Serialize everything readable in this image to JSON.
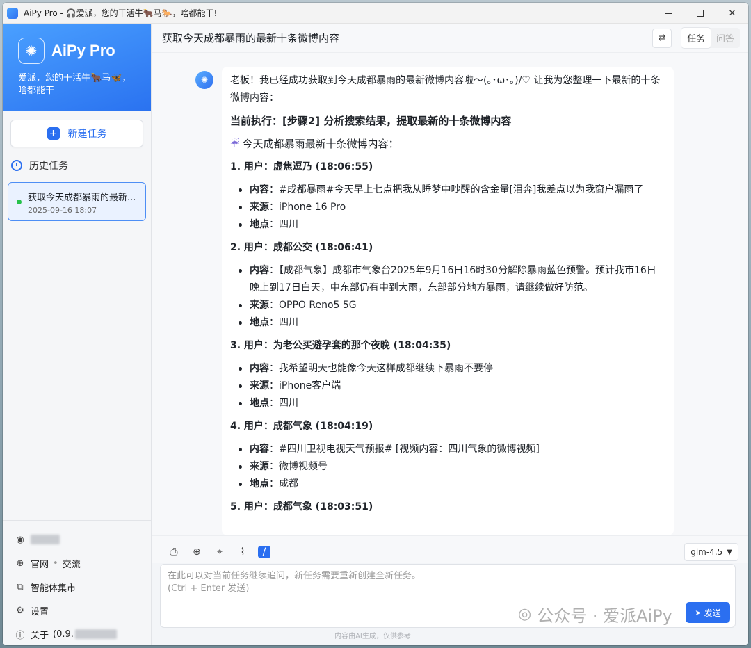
{
  "window": {
    "title": "AiPy Pro - 🎧爱派，您的干活牛🐂马🐎，啥都能干!"
  },
  "sidebar": {
    "brand_name": "AiPy Pro",
    "slogan": "爱派，您的干活牛🐂马🦋，啥都能干",
    "new_task_label": "新建任务",
    "history_label": "历史任务",
    "history": [
      {
        "title": "获取今天成都暴雨的最新...",
        "time": "2025-09-16 18:07",
        "status": "active"
      }
    ],
    "links": {
      "official_site": "官网",
      "community": "交流",
      "agent_market": "智能体集市",
      "settings": "设置",
      "about": "关于",
      "version_prefix": "(0.9."
    }
  },
  "header": {
    "conversation_title": "获取今天成都暴雨的最新十条微博内容",
    "tab_task": "任务",
    "tab_qa": "问答"
  },
  "message": {
    "intro": "老板！我已经成功获取到今天成都暴雨的最新微博内容啦～(｡･ω･｡)/♡ 让我为您整理一下最新的十条微博内容：",
    "current_step": "当前执行：[步骤2] 分析搜索结果，提取最新的十条微博内容",
    "subtitle": "今天成都暴雨最新十条微博内容：",
    "subtitle_icon": "☔",
    "labels": {
      "content": "内容",
      "source": "来源",
      "location": "地点"
    },
    "entries": [
      {
        "head": "1. 用户：虚焦逗乃 (18:06:55)",
        "content": "#成都暴雨#今天早上七点把我从睡梦中吵醒的含金量[泪奔]我差点以为我窗户漏雨了",
        "source": "iPhone 16 Pro",
        "location": "四川"
      },
      {
        "head": "2. 用户：成都公交 (18:06:41)",
        "content": "【成都气象】成都市气象台2025年9月16日16时30分解除暴雨蓝色预警。预计我市16日晚上到17日白天，中东部仍有中到大雨，东部部分地方暴雨，请继续做好防范。",
        "source": "OPPO Reno5 5G",
        "location": "四川"
      },
      {
        "head": "3. 用户：为老公买避孕套的那个夜晚 (18:04:35)",
        "content": "我希望明天也能像今天这样成都继续下暴雨不要停",
        "source": "iPhone客户端",
        "location": "四川"
      },
      {
        "head": "4. 用户：成都气象 (18:04:19)",
        "content": "#四川卫视电视天气预报# [视频内容：四川气象的微博视频]",
        "source": "微博视频号",
        "location": "成都"
      },
      {
        "head": "5. 用户：成都气象 (18:03:51)",
        "content": "",
        "source": "",
        "location": ""
      }
    ]
  },
  "composer": {
    "model": "glm-4.5",
    "placeholder_line1": "在此可以对当前任务继续追问，新任务需要重新创建全新任务。",
    "placeholder_line2": "(Ctrl + Enter 发送)",
    "send_label": "发送",
    "footer_note": "内容由AI生成，仅供参考"
  },
  "watermark": {
    "text": "公众号 · 爱派AiPy"
  },
  "colors": {
    "accent": "#2b6ff0",
    "brand_gradient_start": "#4aa0ff",
    "status_active": "#27c24c"
  }
}
